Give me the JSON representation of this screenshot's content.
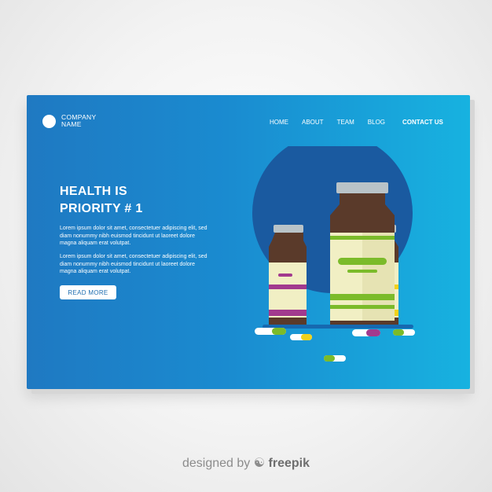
{
  "logo": {
    "name_line1": "COMPANY",
    "name_line2": "NAME"
  },
  "nav": {
    "items": [
      "HOME",
      "ABOUT",
      "TEAM",
      "BLOG"
    ],
    "contact": "CONTACT US"
  },
  "hero": {
    "headline_line1": "HEALTH IS",
    "headline_line2": "PRIORITY # 1",
    "paragraph1": "Lorem ipsum dolor sit amet, consectetuer adipiscing elit, sed diam nonummy nibh euismod tincidunt ut laoreet dolore magna aliquam erat volutpat.",
    "paragraph2": "Lorem ipsum dolor sit amet, consectetuer adipiscing elit, sed diam nonummy nibh euismod tincidunt ut laoreet dolore magna aliquam erat volutpat.",
    "button_label": "READ MORE"
  },
  "illustration": {
    "icons": [
      "medicine-bottle-icon",
      "pill-capsule-icon"
    ],
    "colors": {
      "bottle_glass": "#5a3a2a",
      "cap": "#b9c3c8",
      "label": "#f1efc4",
      "stripe_purple": "#a23a8e",
      "stripe_green": "#7bbb2a",
      "stripe_yellow": "#f2d21c",
      "circle": "#1a5aa0"
    }
  },
  "colors": {
    "card_from": "#1f79c2",
    "card_to": "#17b2e0",
    "button_text": "#1d6db0"
  },
  "watermark": {
    "prefix": "designed by",
    "brand": "freepik"
  }
}
